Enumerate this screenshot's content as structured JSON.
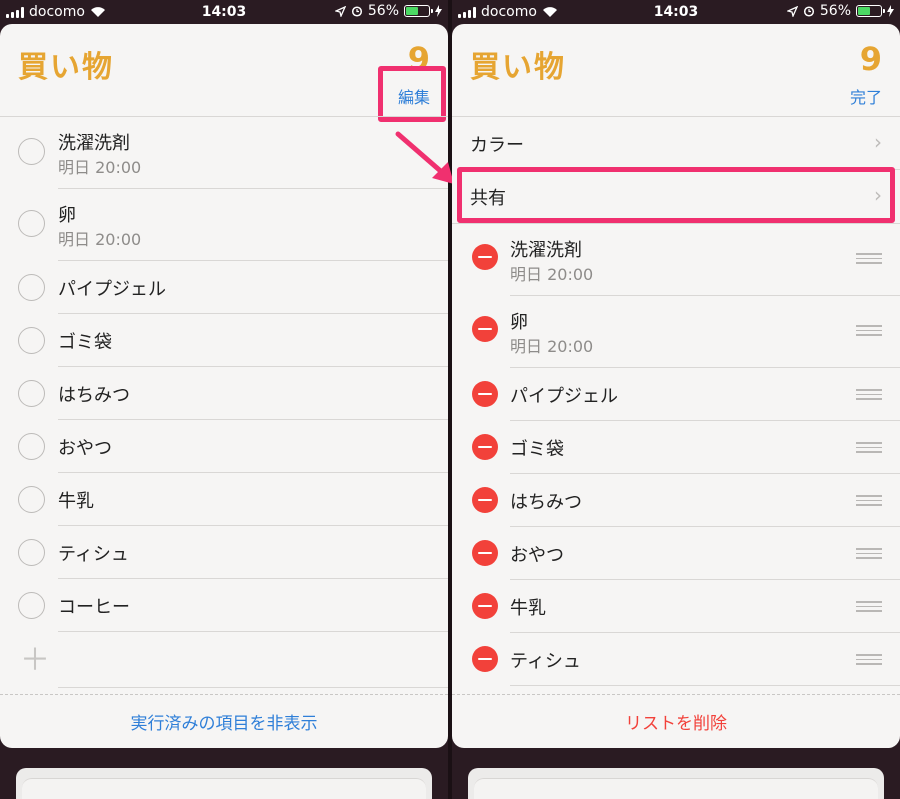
{
  "status": {
    "carrier": "docomo",
    "time": "14:03",
    "battery_pct": "56%",
    "battery_level": 0.56,
    "battery_color": "#4cd964"
  },
  "colors": {
    "accent_title": "#e6a532",
    "link": "#2f7fd8",
    "destructive": "#f2413a",
    "highlight": "#f0306f"
  },
  "left": {
    "title": "買い物",
    "count": "9",
    "edit_label": "編集",
    "items": [
      {
        "title": "洗濯洗剤",
        "sub": "明日 20:00"
      },
      {
        "title": "卵",
        "sub": "明日 20:00"
      },
      {
        "title": "パイプジェル"
      },
      {
        "title": "ゴミ袋"
      },
      {
        "title": "はちみつ"
      },
      {
        "title": "おやつ"
      },
      {
        "title": "牛乳"
      },
      {
        "title": "ティシュ"
      },
      {
        "title": "コーヒー"
      }
    ],
    "add_icon": "plus-icon",
    "footer_label": "実行済みの項目を非表示"
  },
  "right": {
    "title": "買い物",
    "count": "9",
    "done_label": "完了",
    "settings": [
      {
        "label": "カラー"
      },
      {
        "label": "共有"
      }
    ],
    "items": [
      {
        "title": "洗濯洗剤",
        "sub": "明日 20:00"
      },
      {
        "title": "卵",
        "sub": "明日 20:00"
      },
      {
        "title": "パイプジェル"
      },
      {
        "title": "ゴミ袋"
      },
      {
        "title": "はちみつ"
      },
      {
        "title": "おやつ"
      },
      {
        "title": "牛乳"
      },
      {
        "title": "ティシュ"
      }
    ],
    "footer_label": "リストを削除"
  }
}
